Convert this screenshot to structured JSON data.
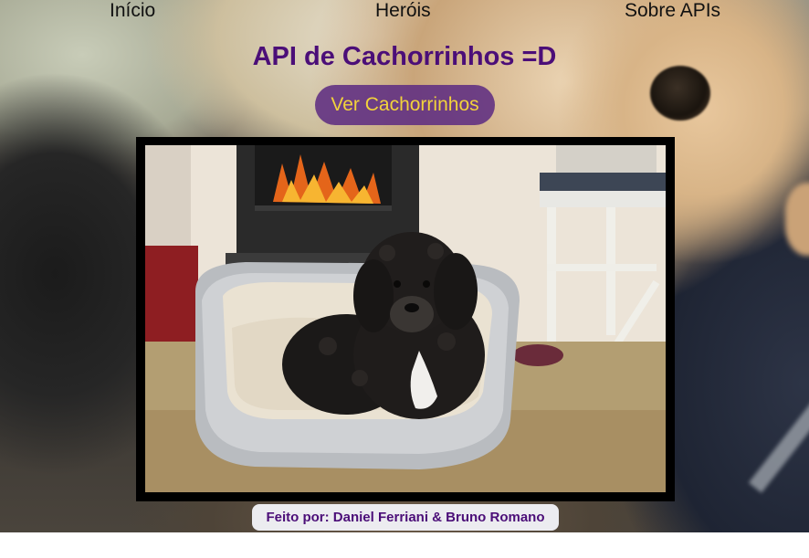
{
  "nav": {
    "items": [
      {
        "label": "Início"
      },
      {
        "label": "Heróis"
      },
      {
        "label": "Sobre APIs"
      }
    ]
  },
  "main": {
    "title": "API de Cachorrinhos =D",
    "button_label": "Ver Cachorrinhos",
    "image": {
      "subject": "dog-in-bed-photo"
    }
  },
  "footer": {
    "credit": "Feito por: Daniel Ferriani & Bruno Romano"
  },
  "colors": {
    "title": "#4b0e78",
    "button_bg": "#5f2d82",
    "button_text": "#f2d33b",
    "frame": "#000000"
  }
}
